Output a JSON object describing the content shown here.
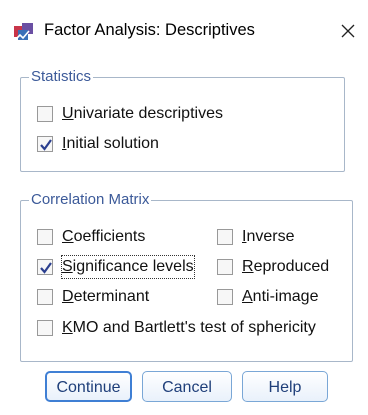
{
  "window": {
    "title": "Factor Analysis: Descriptives",
    "app_icon": "spss-factor-icon",
    "close_icon": "close-icon"
  },
  "statistics": {
    "legend": "Statistics",
    "items": [
      {
        "prefix": "",
        "u": "U",
        "rest": "nivariate descriptives",
        "checked": false
      },
      {
        "prefix": "",
        "u": "I",
        "rest": "nitial solution",
        "checked": true
      }
    ]
  },
  "correlation_matrix": {
    "legend": "Correlation Matrix",
    "items": [
      {
        "prefix": "",
        "u": "C",
        "rest": "oefficients",
        "checked": false
      },
      {
        "prefix": "",
        "u": "I",
        "rest": "nverse",
        "checked": false
      },
      {
        "prefix": "",
        "u": "S",
        "rest": "ignificance levels",
        "checked": true
      },
      {
        "prefix": "",
        "u": "R",
        "rest": "eproduced",
        "checked": false
      },
      {
        "prefix": "",
        "u": "D",
        "rest": "eterminant",
        "checked": false
      },
      {
        "prefix": "",
        "u": "A",
        "rest": "nti-image",
        "checked": false
      },
      {
        "prefix": "",
        "u": "K",
        "rest": "MO and Bartlett's test of sphericity",
        "checked": false
      }
    ]
  },
  "buttons": {
    "continue": "Continue",
    "cancel": "Cancel",
    "help": "Help"
  },
  "colors": {
    "legend_text": "#3c5a99",
    "group_border": "#a8b7c9",
    "button_border": "#7aa7d6",
    "check_mark": "#2b3f8f"
  }
}
